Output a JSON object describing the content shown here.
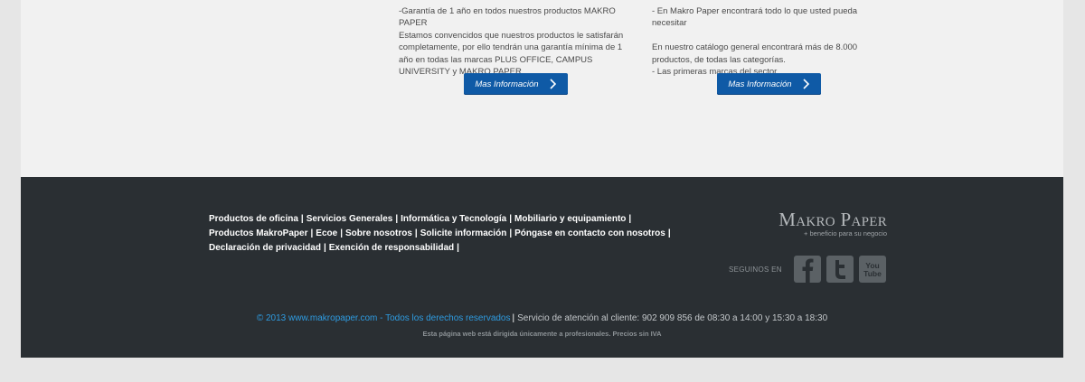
{
  "content": {
    "left": {
      "text": "-Garantía de 1 año en todos nuestros productos MAKRO PAPER\nEstamos convencidos que nuestros productos le satisfarán completamente, por ello tendrán una garantía mínima de 1 año en todas las marcas PLUS OFFICE, CAMPUS UNIVERSITY y MAKRO PAPER...",
      "button_label": "Mas Información"
    },
    "right": {
      "text": "- En Makro Paper encontrará todo lo que usted pueda necesitar\n\nEn nuestro catálogo general encontrará más de 8.000 productos, de todas las categorías.\n- Las primeras marcas del sector",
      "button_label": "Mas Información"
    }
  },
  "footer": {
    "links": [
      "Productos de oficina",
      "Servicios Generales",
      "Informática y Tecnología",
      "Mobiliario y equipamiento",
      "Productos MakroPaper",
      "Ecoe",
      "Sobre nosotros",
      "Solicite información",
      "Póngase en contacto con nosotros",
      "Declaración de privacidad",
      "Exención de responsabilidad"
    ],
    "logo": {
      "name": "Makro Paper",
      "tagline": "+ beneficio para su negocio"
    },
    "follow_label": "SEGUINOS EN",
    "social": [
      {
        "icon": "facebook-icon"
      },
      {
        "icon": "twitter-icon"
      },
      {
        "icon": "youtube-icon",
        "text": "You Tube"
      }
    ],
    "copyright": "© 2013 www.makropaper.com - Todos los derechos reservados",
    "separator": "|",
    "service": "Servicio de atención al cliente: 902 909 856 de 08:30 a 14:00 y 15:30 a 18:30",
    "disclaimer": "Esta página web está dirigida únicamente a profesionales. Precios sin IVA"
  },
  "colors": {
    "accent": "#0f5aa6",
    "footer_bg": "#2a2f33",
    "copyright_link": "#2e9be0"
  }
}
